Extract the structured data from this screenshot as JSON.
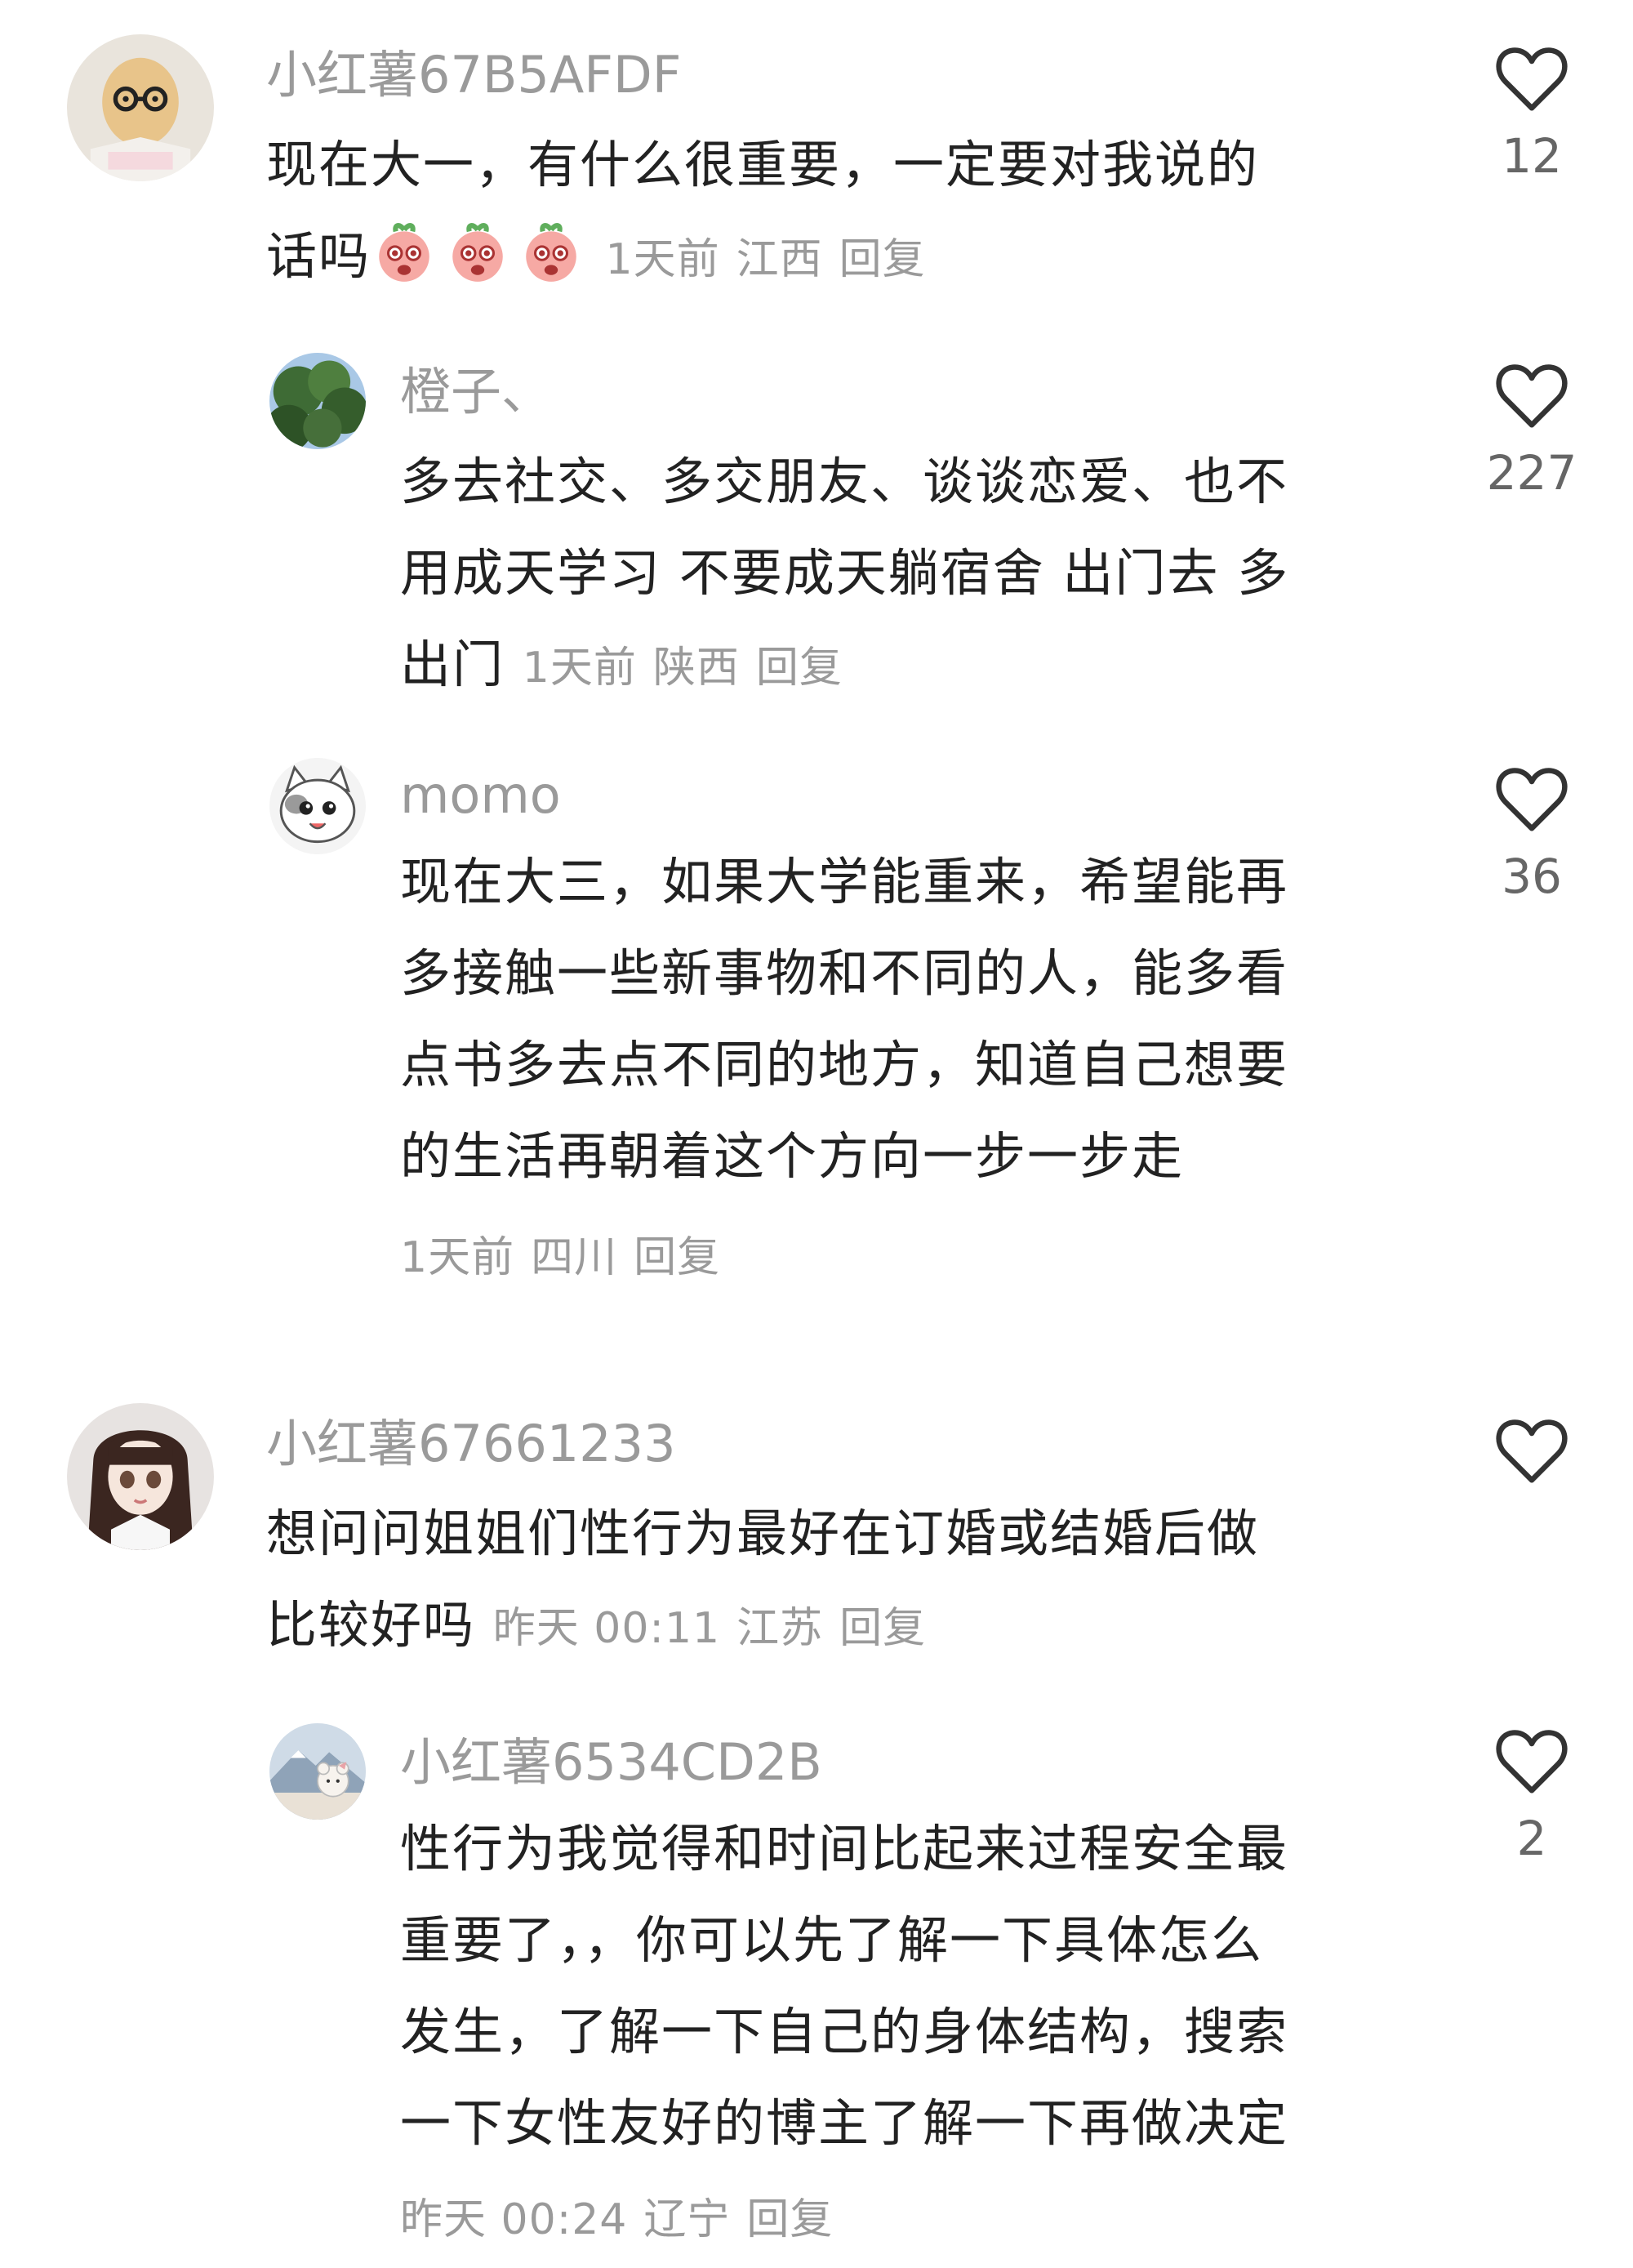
{
  "comments": [
    {
      "username": "小红薯67B5AFDF",
      "lines": [
        "现在大一，有什么很重要，一定要对我说的",
        "话吗"
      ],
      "emoji_count": 3,
      "time": "1天前",
      "location": "江西",
      "reply_label": "回复",
      "likes": "12",
      "avatar": "peanut-glasses-avatar"
    },
    {
      "username": "橙子、",
      "lines": [
        "多去社交、多交朋友、谈谈恋爱、也不",
        "用成天学习 不要成天躺宿舍 出门去 多",
        "出门"
      ],
      "time": "1天前",
      "location": "陕西",
      "reply_label": "回复",
      "likes": "227",
      "avatar": "trees-sky-avatar"
    },
    {
      "username": "momo",
      "lines": [
        "现在大三，如果大学能重来，希望能再",
        "多接触一些新事物和不同的人，能多看",
        "点书多去点不同的地方，知道自己想要",
        "的生活再朝着这个方向一步一步走"
      ],
      "time": "1天前",
      "location": "四川",
      "reply_label": "回复",
      "likes": "36",
      "avatar": "cartoon-cat-avatar"
    },
    {
      "username": "小红薯67661233",
      "lines": [
        "想问问姐姐们性行为最好在订婚或结婚后做",
        "比较好吗"
      ],
      "time": "昨天 00:11",
      "location": "江苏",
      "reply_label": "回复",
      "likes": "",
      "avatar": "doll-girl-avatar"
    },
    {
      "username": "小红薯6534CD2B",
      "lines": [
        "性行为我觉得和时间比起来过程安全最",
        "重要了，，你可以先了解一下具体怎么",
        "发生，了解一下自己的身体结构，搜索",
        "一下女性友好的博主了解一下再做决定"
      ],
      "time": "昨天 00:24",
      "location": "辽宁",
      "reply_label": "回复",
      "likes": "2",
      "avatar": "mountain-bear-avatar"
    }
  ],
  "colors": {
    "text": "#222222",
    "muted": "#9a9a9a",
    "count": "#666666",
    "heart_stroke": "#333333"
  },
  "icons": {
    "like": "heart-outline-icon",
    "emoji": "peach-crying-emoji"
  }
}
